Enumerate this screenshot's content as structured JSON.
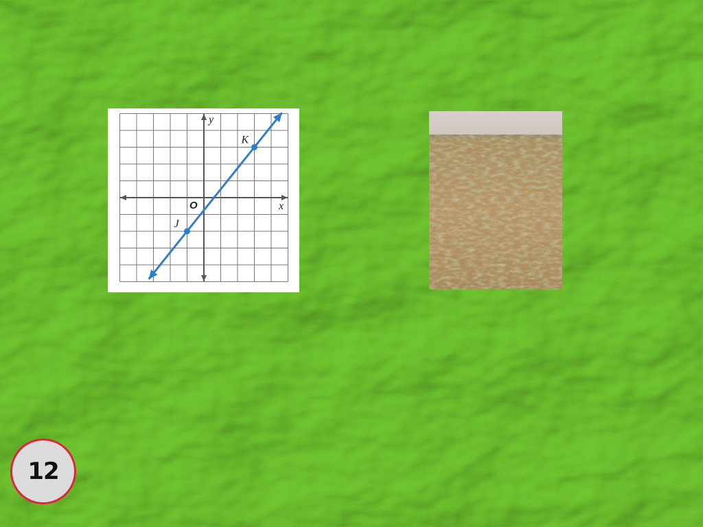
{
  "slide": {
    "number": "12",
    "background_color": "#6cc02e",
    "badge_border_color": "#e0243a",
    "badge_fill_color": "#dcdcdc"
  },
  "graph": {
    "x_axis_label": "x",
    "y_axis_label": "y",
    "origin_label": "O",
    "points": [
      {
        "label": "J",
        "x": -1,
        "y": -2
      },
      {
        "label": "K",
        "x": 3,
        "y": 3
      }
    ],
    "line_color": "#2f7fc8",
    "grid_color": "#777777"
  },
  "photo": {
    "subject": "grassland-plain"
  }
}
